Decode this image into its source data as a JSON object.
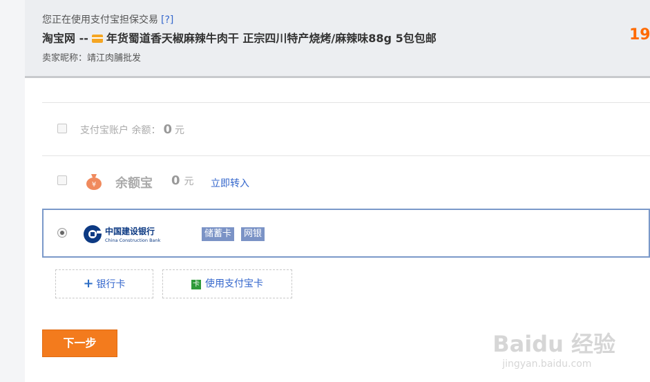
{
  "header": {
    "notice": "您正在使用支付宝担保交易",
    "help": "[?]",
    "site": "淘宝网 --",
    "product": "年货蜀道香天椒麻辣牛肉干 正宗四川特产烧烤/麻辣味88g 5包包邮",
    "seller": "卖家昵称：靖江肉脯批发",
    "price_partial": "19"
  },
  "alipay_balance": {
    "label": "支付宝账户 余额：",
    "amount": "0",
    "unit": "元"
  },
  "yuebao": {
    "name": "余额宝",
    "amount": "0",
    "unit": "元",
    "link": "立即转入"
  },
  "bank": {
    "logo_cn": "中国建设银行",
    "logo_en": "China Construction Bank",
    "tags": [
      "储蓄卡",
      "网银"
    ]
  },
  "add_bank_card": {
    "label": "银行卡"
  },
  "alipay_card": {
    "label": "使用支付宝卡",
    "icon_text": "卡"
  },
  "next_button": "下一步",
  "watermark": {
    "main": "Baidu 经验",
    "sub": "jingyan.baidu.com"
  },
  "colors": {
    "accent": "#f37b1d",
    "link": "#3366cc",
    "price": "#ff6a00",
    "tag": "#7b93c6"
  }
}
